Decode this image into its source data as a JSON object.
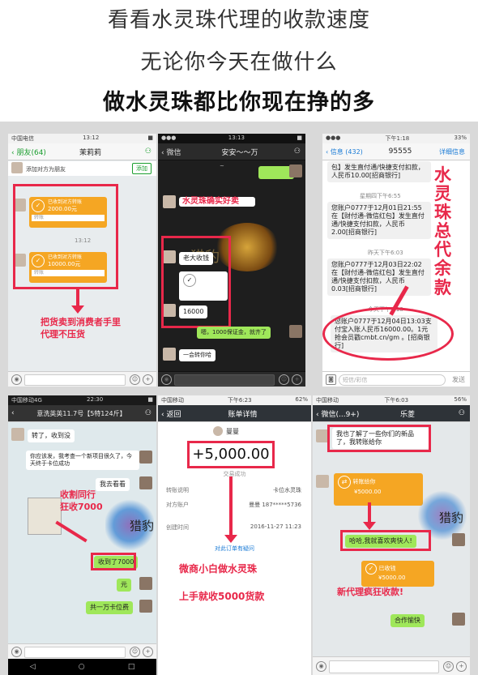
{
  "header": {
    "line1": "看看水灵珠代理的收款速度",
    "line2": "无论你今天在做什么",
    "line3": "做水灵珠都比你现在挣的多"
  },
  "p1": {
    "status_left": "中国电信",
    "status_time": "13:12",
    "back": "朋友(64)",
    "title": "茉莉莉",
    "add_note": "添加对方为朋友",
    "add_btn": "添加",
    "transfer1_amount": "2000.00元",
    "transfer1_label": "已收到对方转账",
    "transfer1_note": "转账",
    "time_mid": "13:12",
    "transfer2_amount": "10000.00元",
    "transfer2_label": "已收到对方转账",
    "transfer2_note": "转账",
    "caption": "把货卖到消费者手里\n代理不压货"
  },
  "p2": {
    "status_time": "13:13",
    "back": "微信",
    "title": "安安～～万",
    "caption": "水灵珠确实好卖",
    "msg_collect": "老大收钱",
    "msg_amount": "16000",
    "msg_reply": "嗯，1000保证金，就齐了",
    "msg_last": "一会转你哈",
    "watermark": "猎豹"
  },
  "p3": {
    "status_time": "下午1:18",
    "status_batt": "33%",
    "back": "信息 (432)",
    "title": "95555",
    "detail": "详细信息",
    "sms1": "包】发生直付通/快捷支付扣款，人民币10.00[招商银行]",
    "ts1": "星期四下午6:55",
    "sms2": "您账户0777于12月01日21:55在【财付通-微信红包】发生直付通/快捷支付扣款，人民币2.00[招商银行]",
    "ts2": "昨天下午6:03",
    "sms3": "您账户0777于12月03日22:02在【财付通-微信红包】发生直付通/快捷支付扣款，人民币0.03[招商银行]",
    "ts3": "今天下午1:18",
    "sms4": "您账户0777于12月04日13:03支付宝入账人民币16000.00。1元抢会员戳cmbt.cn/gm 。[招商银行]",
    "vertical": "水灵珠总代余款",
    "input_placeholder": "短信/彩信",
    "send": "发送"
  },
  "p4": {
    "status_left": "中国移动4G",
    "status_time": "22:30",
    "title": "意洗英英11.7号【5特124斤】",
    "msg1": "转了，收到没",
    "msg2": "你应该发，我考查一个新项目很久了，今天终于卡位成功",
    "msg3": "我去看看",
    "msg4": "收到了7000",
    "msg5": "元",
    "msg6": "共一万卡位费",
    "caption": "收割同行\n狂收7000",
    "watermark": "猎豹"
  },
  "p5": {
    "status_left": "中国移动",
    "status_time": "下午6:23",
    "status_batt": "62%",
    "back": "返回",
    "title": "账单详情",
    "name": "曼曼",
    "amount": "+5,000.00",
    "status": "交易成功",
    "row1_label": "转账说明",
    "row1_value": "卡位水灵珠",
    "row2_label": "对方账户",
    "row2_value": "曼曼 187*****5736",
    "row3_label": "创建时间",
    "row3_value": "2016-11-27 11:23",
    "link": "对此订单有疑问",
    "caption1": "微商小白做水灵珠",
    "caption2": "上手就收5000货款"
  },
  "p6": {
    "status_left": "中国移动",
    "status_time": "下午6:03",
    "status_batt": "56%",
    "back": "微信(...9+)",
    "title": "乐菱",
    "msg1": "我也了解了一些你们的新品了，我转账给你",
    "transfer_label": "转账给你",
    "transfer_amount": "¥5000.00",
    "msg2": "哈哈,我就喜欢爽快人!",
    "received": "已收钱",
    "received_amount": "¥5000.00",
    "caption": "新代理疯狂收款!",
    "msg_last": "合作愉快",
    "watermark": "猎豹"
  },
  "colors": {
    "accent_red": "#e8284a",
    "wechat_green": "#9fe75a",
    "transfer_orange": "#f5a623"
  }
}
